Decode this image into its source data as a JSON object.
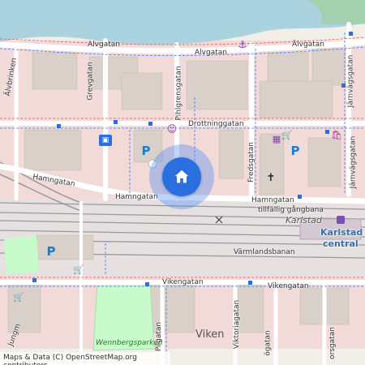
{
  "map": {
    "streets": {
      "alvgatan_w": "Alvgatan",
      "alvgatan_e": "Älvgatan",
      "alvgatan_mid": "Alvgatan",
      "alvbrinken": "Älvbrinken",
      "grevgatan": "Grevgatan",
      "pihlgrensgatan": "Pihlgrensgatan",
      "drottninggatan": "Drottninggatan",
      "fredsgatan": "Fredsgatan",
      "jarnvagsgatan_1": "Järnvägsgatan",
      "jarnvagsgatan_2": "Järnvägsgatan",
      "hamngatan_w": "Hamngatan",
      "hamngatan_mid": "Hamngatan",
      "hamngatan_e": "Hamngatan",
      "tillfallig": "tillfällig gångbana",
      "varmlandsbanan": "Värmlandsbanan",
      "vikengatan_w": "Vikengatan",
      "vikengatan_e": "Vikengatan",
      "pilgatan": "Pilgatan",
      "viktoriagatan": "Viktoriagatan",
      "jungm": "Jungm",
      "ogatan": "ögatan",
      "orsgatan": "orsgatan"
    },
    "places": {
      "viken": "Viken",
      "karlstad": "Karlstad",
      "karlstad_central_1": "Karlstad",
      "karlstad_central_2": "central",
      "wennbergsparken": "Wennbergsparken"
    },
    "attribution": "Maps & Data (C) OpenStreetMap.org contributors",
    "colors": {
      "water": "#aad3df",
      "residential": "#f2dad9",
      "building": "#d9d0c9",
      "park": "#c8facc",
      "pin": "#2a6fe0"
    },
    "icons": [
      "parking-icon",
      "theatre-icon",
      "bus-station-icon",
      "cinema-icon",
      "church-icon",
      "shop-icon",
      "anchor-icon",
      "home-pin-icon"
    ]
  }
}
